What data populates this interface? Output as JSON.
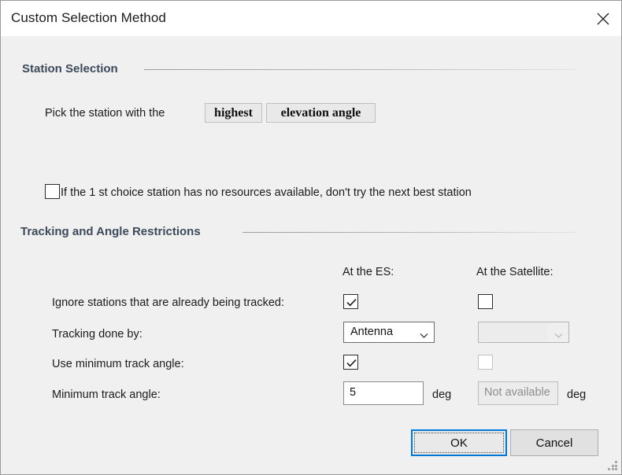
{
  "window": {
    "title": "Custom Selection Method",
    "close_icon": "close-icon"
  },
  "station_selection": {
    "header": "Station Selection",
    "pick_label": "Pick the station with the",
    "criteria": [
      {
        "label": "highest"
      },
      {
        "label": "elevation angle"
      }
    ],
    "no_retry_checkbox": {
      "label": "If the 1 st choice station has no resources available, don't try the next best station",
      "checked": false
    }
  },
  "tracking_restrictions": {
    "header": "Tracking and Angle Restrictions",
    "columns": {
      "es": "At the ES:",
      "satellite": "At the Satellite:"
    },
    "rows": {
      "ignore_tracked": {
        "label": "Ignore stations that are already being tracked:",
        "es_checked": true,
        "sat_checked": false
      },
      "tracking_done_by": {
        "label": "Tracking done by:",
        "es_value": "Antenna",
        "sat_value": "",
        "sat_disabled": true
      },
      "use_min_track_angle": {
        "label": "Use minimum track angle:",
        "es_checked": true,
        "sat_checked": false,
        "sat_disabled": true
      },
      "min_track_angle": {
        "label": "Minimum track angle:",
        "es_value": "5",
        "es_unit": "deg",
        "sat_value": "Not available",
        "sat_unit": "deg",
        "sat_disabled": true
      }
    }
  },
  "footer": {
    "ok_label": "OK",
    "cancel_label": "Cancel"
  },
  "colors": {
    "accent": "#0078d7",
    "group_header": "#3c4a5a",
    "body_background": "#f0f0f0",
    "titlebar_background": "#ffffff"
  }
}
